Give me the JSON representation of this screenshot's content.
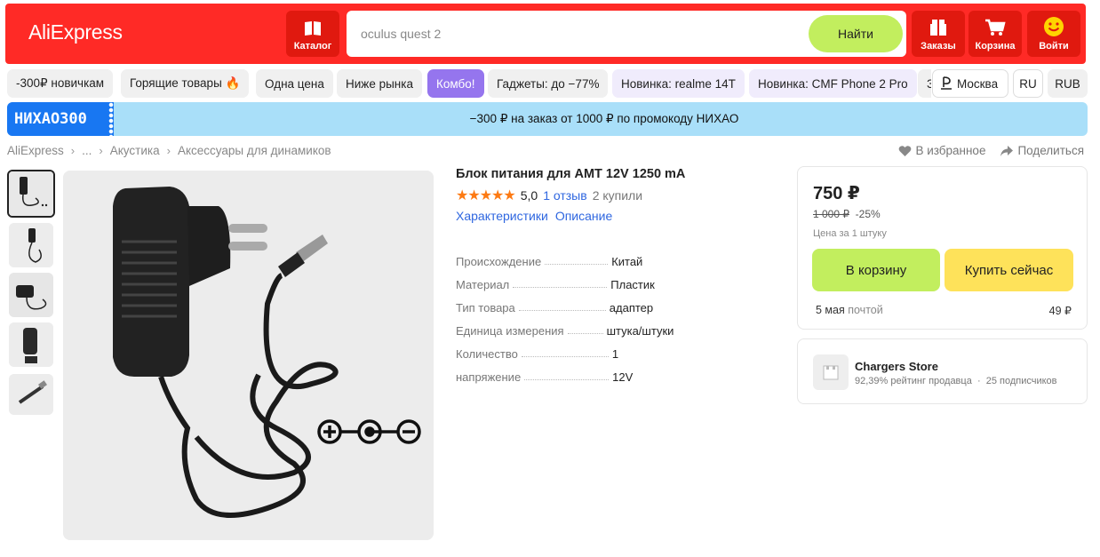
{
  "header": {
    "logo": "AliExpress",
    "catalog_label": "Каталог",
    "search_placeholder": "oculus quest 2",
    "search_button": "Найти",
    "orders_label": "Заказы",
    "cart_label": "Корзина",
    "login_label": "Войти"
  },
  "pills": [
    "-300₽ новичкам",
    "Горящие товары 🔥",
    "Одна цена",
    "Ниже рынка",
    "Комбо!",
    "Гаджеты: до −77%",
    "Новинка: realme 14T",
    "Новинка: CMF Phone 2 Pro",
    "З"
  ],
  "locale": {
    "city": "Москва",
    "language": "RU",
    "currency": "RUB"
  },
  "promo": {
    "code": "НИХАО300",
    "text": "−300 ₽ на заказ от 1000 ₽ по промокоду НИХАО"
  },
  "breadcrumb": [
    "AliExpress",
    "...",
    "Акустика",
    "Аксессуары для динамиков"
  ],
  "actions": {
    "favorite": "В избранное",
    "share": "Поделиться"
  },
  "product": {
    "title": "Блок питания для AMT 12V 1250 mA",
    "stars": "★★★★★",
    "rating": "5,0",
    "reviews": "1 отзыв",
    "bought": "2 купили",
    "tab_specs": "Характеристики",
    "tab_desc": "Описание",
    "specs": [
      {
        "k": "Происхождение",
        "v": "Китай"
      },
      {
        "k": "Материал",
        "v": "Пластик"
      },
      {
        "k": "Тип товара",
        "v": "адаптер"
      },
      {
        "k": "Единица измерения",
        "v": "штука/штуки"
      },
      {
        "k": "Количество",
        "v": "1"
      },
      {
        "k": "напряжение",
        "v": "12V"
      }
    ]
  },
  "buy": {
    "price": "750 ₽",
    "old_price": "1 000 ₽",
    "discount": "-25%",
    "unit_note": "Цена за 1 штуку",
    "cart_button": "В корзину",
    "buy_button": "Купить сейчас",
    "delivery_date": "5 мая",
    "delivery_method": "почтой",
    "delivery_cost": "49 ₽"
  },
  "store": {
    "name": "Chargers Store",
    "rating": "92,39% рейтинг продавца",
    "subscribers": "25 подписчиков"
  },
  "colors": {
    "brand_red": "#ff2a26",
    "accent_green": "#c2ee5e",
    "buy_yellow": "#fee25a",
    "link_blue": "#2f67e0",
    "star_orange": "#fd7a13"
  }
}
